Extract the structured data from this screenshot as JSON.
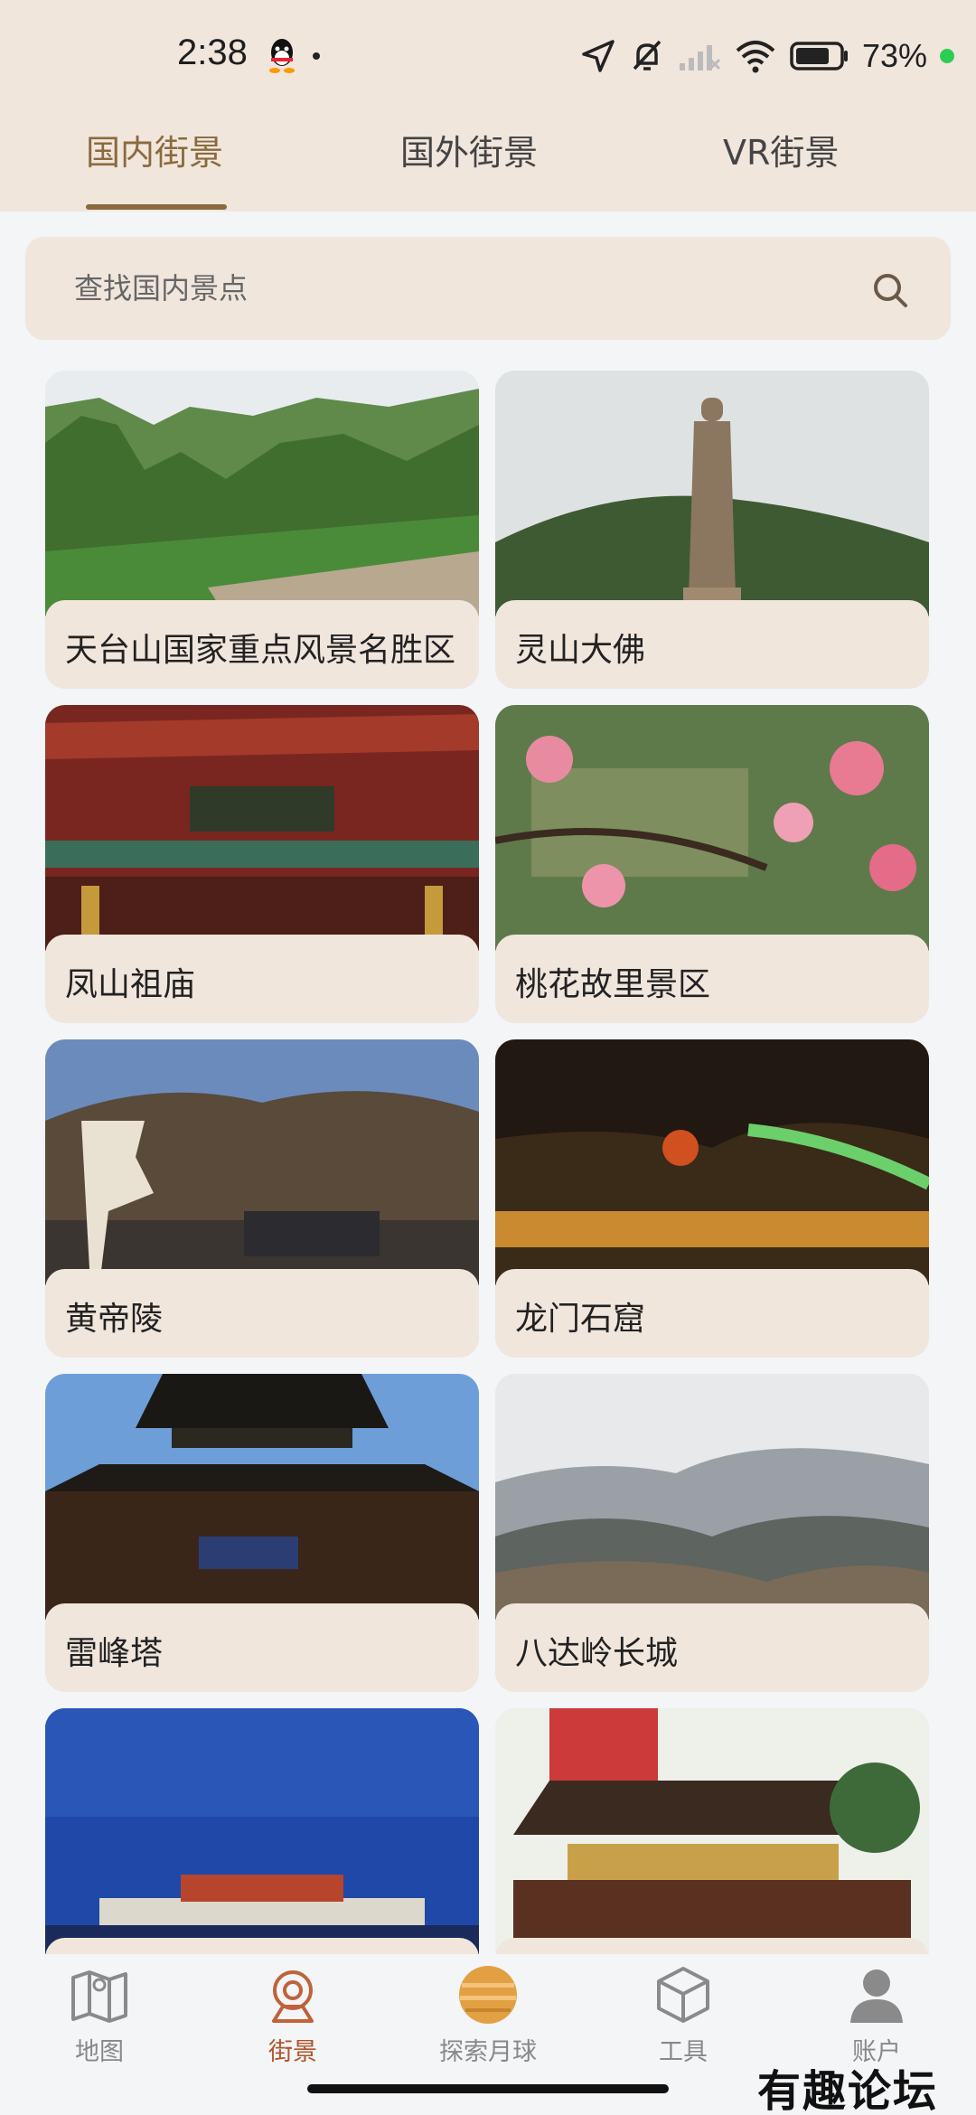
{
  "status_bar": {
    "time": "2:38",
    "battery": "73%"
  },
  "tabs": [
    {
      "label": "国内街景",
      "active": true
    },
    {
      "label": "国外街景",
      "active": false
    },
    {
      "label": "VR街景",
      "active": false
    }
  ],
  "search": {
    "placeholder": "查找国内景点"
  },
  "spots": [
    {
      "name": "天台山国家重点风景名胜区"
    },
    {
      "name": "灵山大佛"
    },
    {
      "name": "凤山祖庙"
    },
    {
      "name": "桃花故里景区"
    },
    {
      "name": "黄帝陵"
    },
    {
      "name": "龙门石窟"
    },
    {
      "name": "雷峰塔"
    },
    {
      "name": "八达岭长城"
    },
    {
      "name": ""
    },
    {
      "name": ""
    }
  ],
  "bottom_nav": [
    {
      "label": "地图",
      "icon": "map-icon",
      "active": false
    },
    {
      "label": "街景",
      "icon": "street-view-icon",
      "active": true
    },
    {
      "label": "探索月球",
      "icon": "moon-icon",
      "active": false
    },
    {
      "label": "工具",
      "icon": "cube-icon",
      "active": false
    },
    {
      "label": "账户",
      "icon": "account-icon",
      "active": false
    }
  ],
  "watermark": "有趣论坛",
  "colors": {
    "header_bg": "#f0e6dc",
    "accent": "#8a6a3e",
    "nav_active": "#b0532c"
  }
}
